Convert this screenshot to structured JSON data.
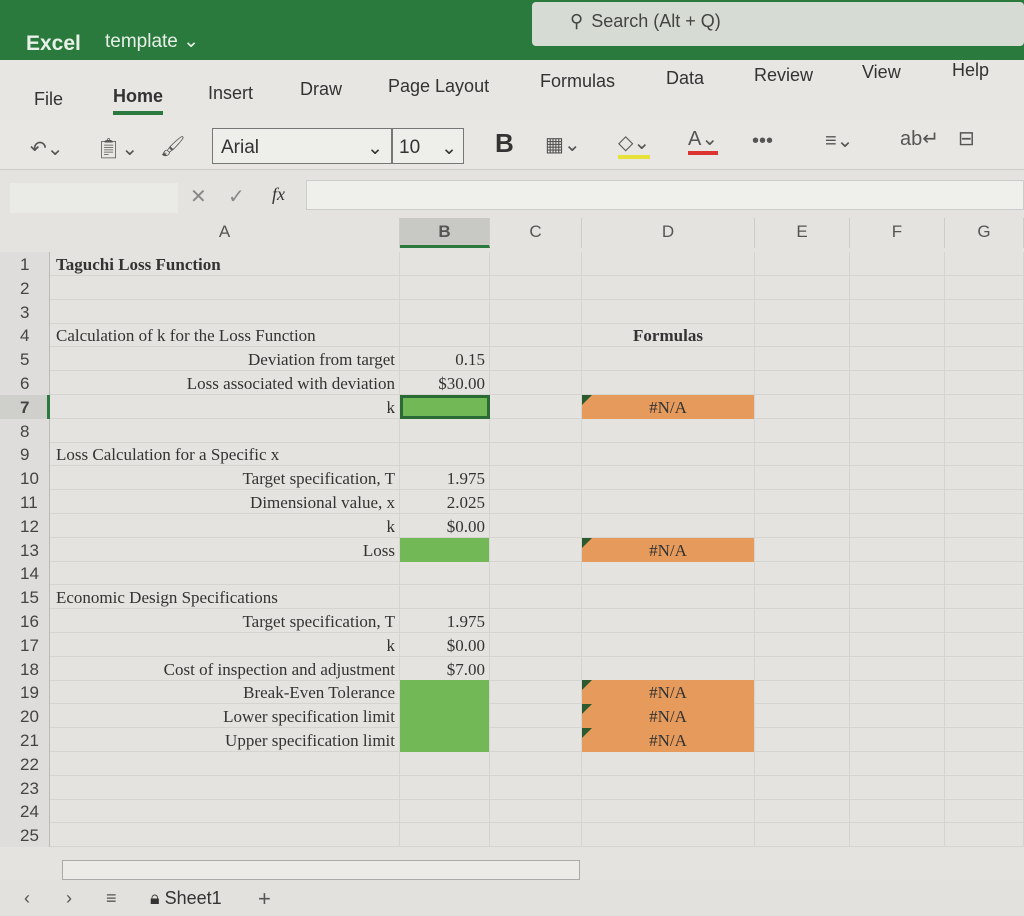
{
  "app": {
    "name": "Excel",
    "document": "template",
    "search_placeholder": "Search (Alt + Q)"
  },
  "tabs": [
    "File",
    "Home",
    "Insert",
    "Draw",
    "Page Layout",
    "Formulas",
    "Data",
    "Review",
    "View",
    "Help"
  ],
  "active_tab": "Home",
  "ribbon": {
    "font": "Arial",
    "size": "10",
    "bold": "B",
    "more": "•••"
  },
  "formula_bar": {
    "fx": "fx",
    "value": ""
  },
  "columns": [
    "A",
    "B",
    "C",
    "D",
    "E",
    "F",
    "G"
  ],
  "selected_cell": "B7",
  "colors": {
    "accent": "#2a7a3d",
    "input_fill": "#72b857",
    "formula_fill": "#e69b5c"
  },
  "rows": [
    {
      "A": "Taguchi Loss Function",
      "A_bold": true
    },
    {},
    {},
    {
      "A": "Calculation of k for the Loss Function",
      "D": "Formulas",
      "D_bold": true
    },
    {
      "A": "Deviation from target",
      "A_right": true,
      "B": "0.15"
    },
    {
      "A": "Loss associated with deviation",
      "A_right": true,
      "B": "$30.00"
    },
    {
      "A": "k",
      "A_right": true,
      "B_fill": "green",
      "D": "#N/A",
      "D_fill": "orange"
    },
    {},
    {
      "A": "Loss Calculation for a Specific x"
    },
    {
      "A": "Target specification, T",
      "A_right": true,
      "B": "1.975"
    },
    {
      "A": "Dimensional value, x",
      "A_right": true,
      "B": "2.025"
    },
    {
      "A": "k",
      "A_right": true,
      "B": "$0.00"
    },
    {
      "A": "Loss",
      "A_right": true,
      "B_fill": "green",
      "D": "#N/A",
      "D_fill": "orange"
    },
    {},
    {
      "A": "Economic Design Specifications"
    },
    {
      "A": "Target specification, T",
      "A_right": true,
      "B": "1.975"
    },
    {
      "A": "k",
      "A_right": true,
      "B": "$0.00"
    },
    {
      "A": "Cost of inspection and adjustment",
      "A_right": true,
      "B": "$7.00"
    },
    {
      "A": "Break-Even Tolerance",
      "A_right": true,
      "B_fill": "green",
      "D": "#N/A",
      "D_fill": "orange"
    },
    {
      "A": "Lower specification limit",
      "A_right": true,
      "B_fill": "green",
      "D": "#N/A",
      "D_fill": "orange"
    },
    {
      "A": "Upper specification limit",
      "A_right": true,
      "B_fill": "green",
      "D": "#N/A",
      "D_fill": "orange"
    },
    {},
    {},
    {},
    {}
  ],
  "sheets": [
    "Sheet1"
  ],
  "add_sheet": "+"
}
